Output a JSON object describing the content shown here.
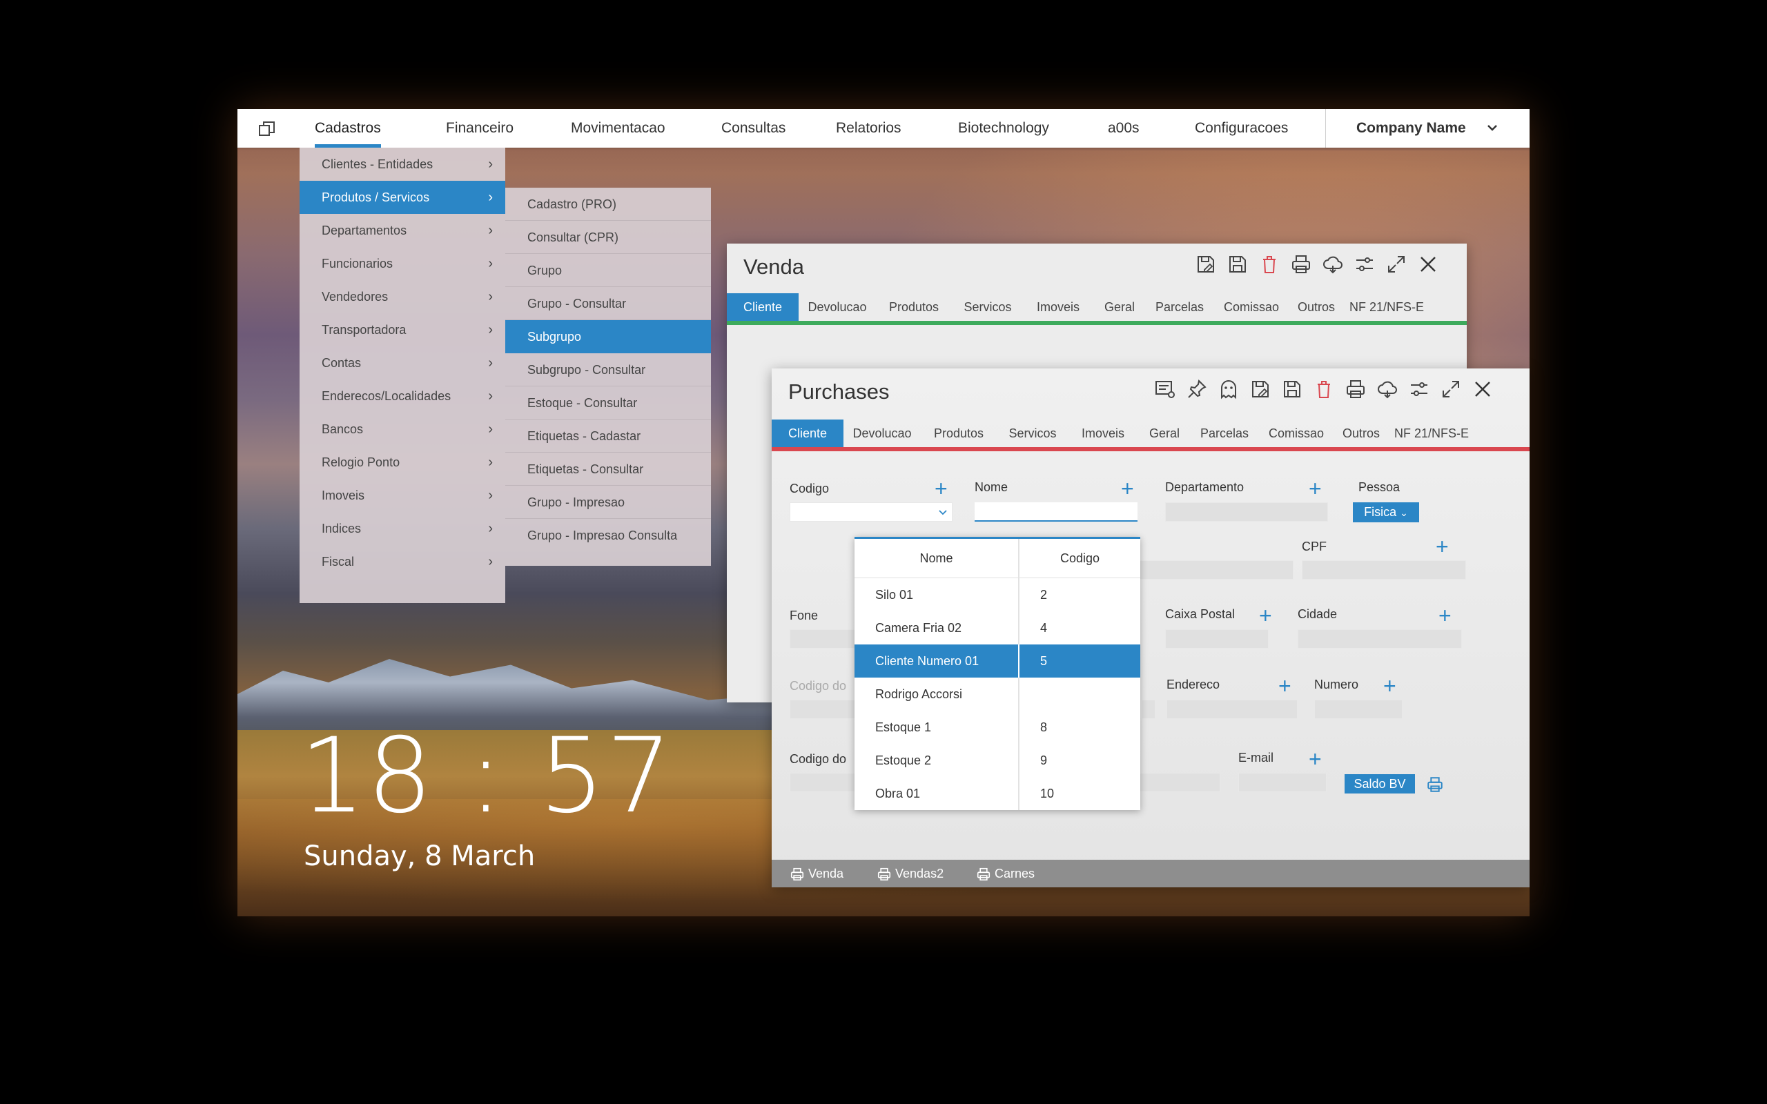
{
  "menubar": {
    "items": [
      {
        "label": "Cadastros"
      },
      {
        "label": "Financeiro"
      },
      {
        "label": "Movimentacao"
      },
      {
        "label": "Consultas"
      },
      {
        "label": "Relatorios"
      },
      {
        "label": "Biotechnology"
      },
      {
        "label": "a00s"
      },
      {
        "label": "Configuracoes"
      }
    ],
    "active_index": 0,
    "company": "Company Name"
  },
  "menu1": {
    "items": [
      {
        "label": "Clientes - Entidades"
      },
      {
        "label": "Produtos / Servicos"
      },
      {
        "label": "Departamentos"
      },
      {
        "label": "Funcionarios"
      },
      {
        "label": "Vendedores"
      },
      {
        "label": "Transportadora"
      },
      {
        "label": "Contas"
      },
      {
        "label": "Enderecos/Localidades"
      },
      {
        "label": "Bancos"
      },
      {
        "label": "Relogio Ponto"
      },
      {
        "label": "Imoveis"
      },
      {
        "label": "Indices"
      },
      {
        "label": "Fiscal"
      }
    ],
    "selected_index": 1
  },
  "menu2": {
    "items": [
      {
        "label": "Cadastro (PRO)"
      },
      {
        "label": "Consultar (CPR)"
      },
      {
        "label": "Grupo"
      },
      {
        "label": "Grupo - Consultar"
      },
      {
        "label": "Subgrupo"
      },
      {
        "label": "Subgrupo - Consultar"
      },
      {
        "label": "Estoque - Consultar"
      },
      {
        "label": "Etiquetas - Cadastar"
      },
      {
        "label": "Etiquetas - Consultar"
      },
      {
        "label": "Grupo - Impresao"
      },
      {
        "label": "Grupo - Impresao Consulta"
      }
    ],
    "selected_index": 4
  },
  "clock": {
    "time": "18 : 57",
    "date": "Sunday, 8 March"
  },
  "venda": {
    "title": "Venda",
    "tabs": [
      "Cliente",
      "Devolucao",
      "Produtos",
      "Servicos",
      "Imoveis",
      "Geral",
      "Parcelas",
      "Comissao",
      "Outros",
      "NF 21/NFS-E"
    ],
    "active_tab": 0,
    "icons": [
      "save-edit-icon",
      "save-icon",
      "delete-icon",
      "print-icon",
      "cloud-icon",
      "settings-sliders-icon",
      "expand-icon",
      "close-icon"
    ]
  },
  "purchases": {
    "title": "Purchases",
    "tabs": [
      "Cliente",
      "Devolucao",
      "Produtos",
      "Servicos",
      "Imoveis",
      "Geral",
      "Parcelas",
      "Comissao",
      "Outros",
      "NF 21/NFS-E"
    ],
    "active_tab": 0,
    "icons": [
      "list-settings-icon",
      "pin-icon",
      "ghost-icon",
      "save-edit-icon",
      "save-icon",
      "delete-icon",
      "print-icon",
      "cloud-icon",
      "settings-sliders-icon",
      "expand-icon",
      "close-icon"
    ],
    "fields": {
      "codigo": "Codigo",
      "nome": "Nome",
      "departamento": "Departamento",
      "pessoa": "Pessoa",
      "pessoa_value": "Fisica",
      "cpf": "CPF",
      "fone": "Fone",
      "caixa_postal": "Caixa Postal",
      "cidade": "Cidade",
      "codigo_do_1": "Codigo do",
      "endereco": "Endereco",
      "numero": "Numero",
      "codigo_do_2": "Codigo do",
      "email": "E-mail",
      "saldo_btn": "Saldo BV"
    },
    "dropdown": {
      "headers": [
        "Nome",
        "Codigo"
      ],
      "rows": [
        {
          "nome": "Silo 01",
          "codigo": "2"
        },
        {
          "nome": "Camera Fria 02",
          "codigo": "4"
        },
        {
          "nome": "Cliente Numero 01",
          "codigo": "5"
        },
        {
          "nome": "Rodrigo Accorsi",
          "codigo": ""
        },
        {
          "nome": "Estoque 1",
          "codigo": "8"
        },
        {
          "nome": "Estoque 2",
          "codigo": "9"
        },
        {
          "nome": "Obra 01",
          "codigo": "10"
        }
      ],
      "selected_index": 2
    },
    "bottombar": [
      "Venda",
      "Vendas2",
      "Carnes"
    ]
  },
  "colors": {
    "accent": "#2b86c6",
    "venda_tab_line": "#3daa5c",
    "purchases_tab_line": "#d9474f",
    "delete_icon": "#d9474f"
  }
}
